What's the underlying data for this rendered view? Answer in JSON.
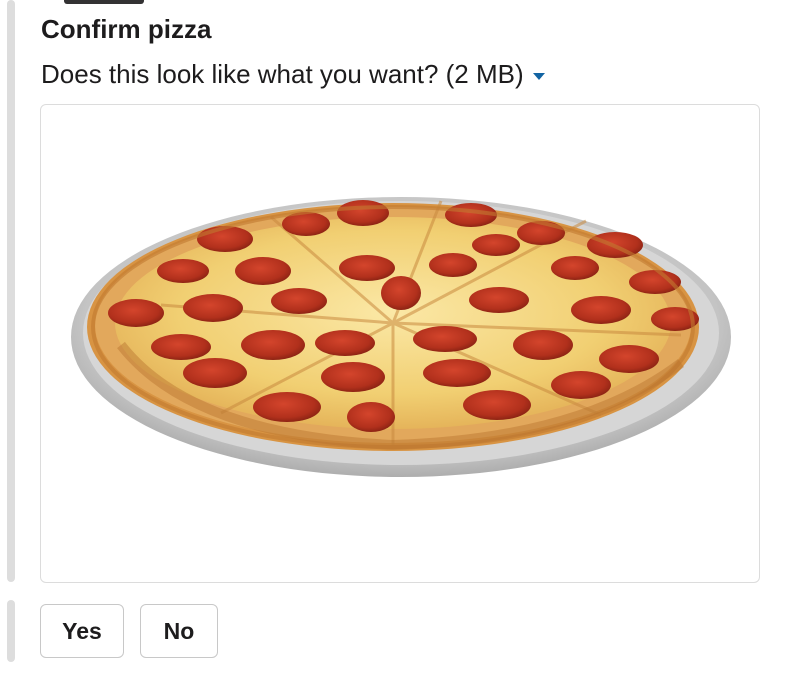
{
  "message": {
    "title": "Confirm pizza",
    "subtitle": "Does this look like what you want? (2 MB)",
    "image_alt": "pepperoni pizza"
  },
  "actions": {
    "yes_label": "Yes",
    "no_label": "No"
  },
  "colors": {
    "accent": "#1264a3",
    "rail": "#dddddd",
    "crust": "#d99a4a",
    "cheese": "#f3d27a",
    "pepperoni": "#b8321f",
    "pan": "#c9c9c9"
  },
  "icons": {
    "dropdown": "caret-down-icon"
  }
}
